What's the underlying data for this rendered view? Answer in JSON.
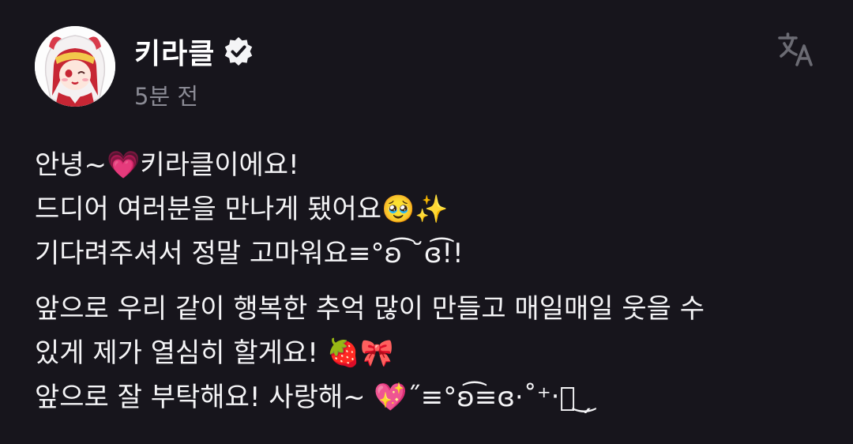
{
  "header": {
    "author_name": "키라클",
    "timestamp": "5분 전",
    "verified": true,
    "translate_icon": "translate-icon"
  },
  "post": {
    "paragraphs": [
      {
        "lines": [
          "안녕~💗키라클이에요!",
          "드디어 여러분을 만나게 됐어요🥹✨",
          "기다려주셔서 정말 고마워요≡°ʚ͡ ˘ɞ͡!!"
        ]
      },
      {
        "lines": [
          "앞으로 우리 같이 행복한 추억 많이 만들고 매일매일 웃을 수",
          "있게 제가 열심히 할게요! 🍓🎀",
          "앞으로 잘 부탁해요! 사랑해~ 💖˝≡°ʚ͡≡ɞ·˚⁺‧͙ ͜ ̗"
        ]
      }
    ]
  },
  "colors": {
    "background": "#17151c",
    "text": "#f4f4f6",
    "muted": "#8a8a94",
    "icon": "#6b6b73"
  }
}
